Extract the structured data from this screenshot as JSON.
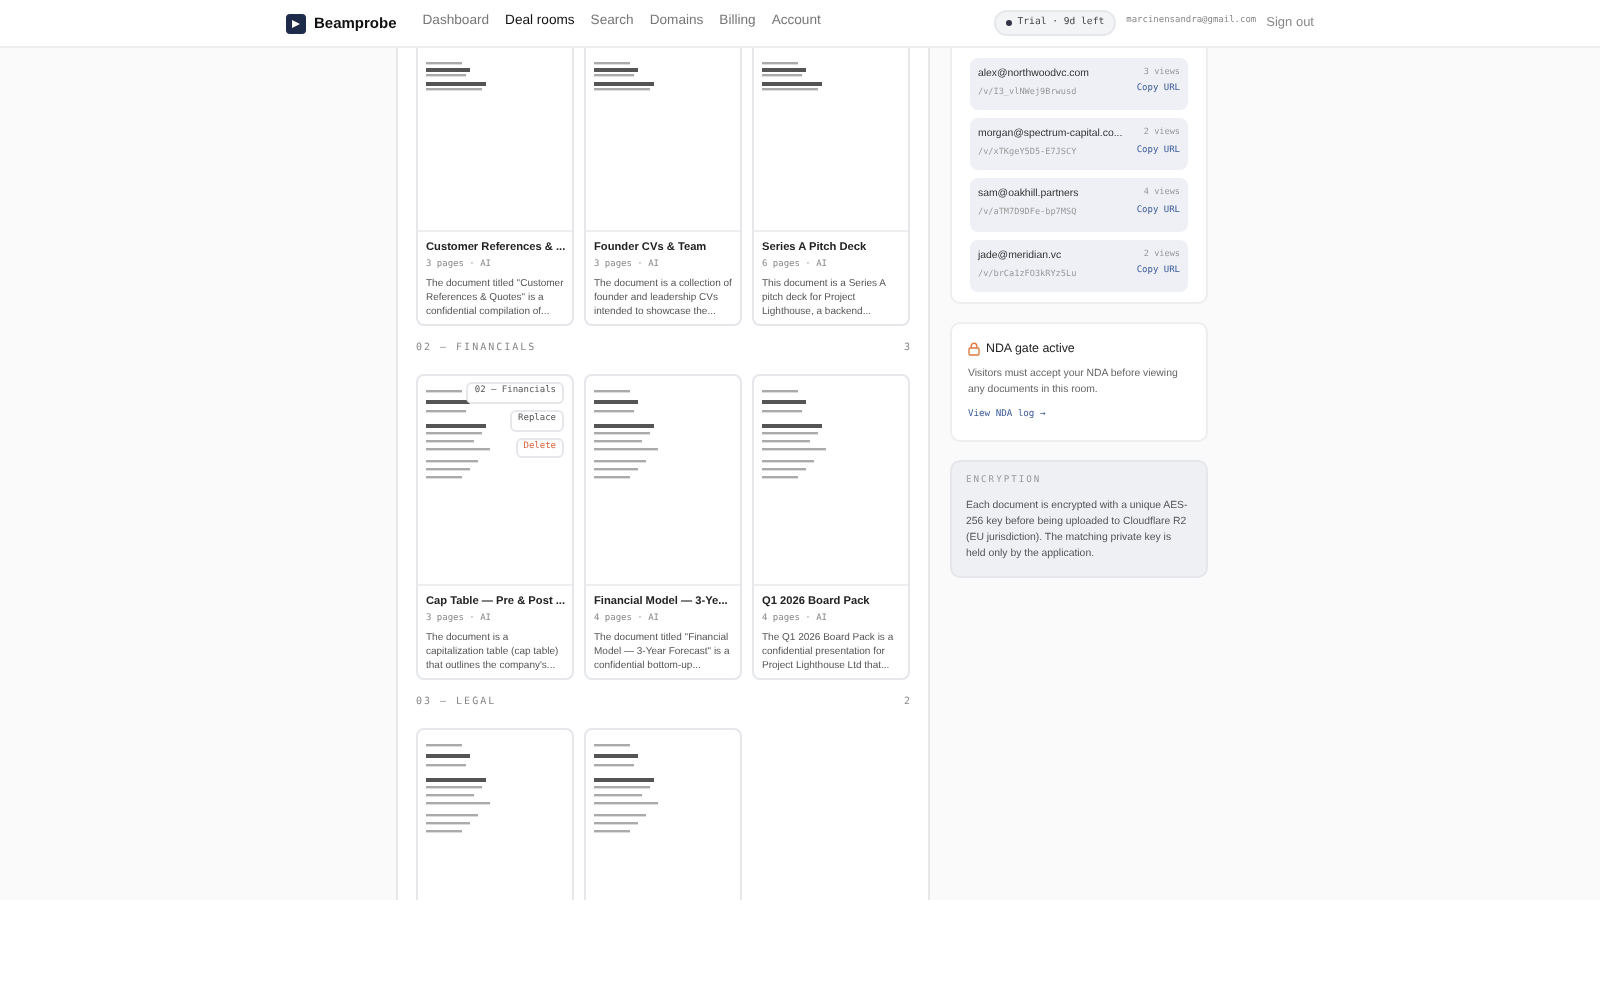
{
  "header": {
    "brand": "Beamprobe",
    "nav": [
      {
        "label": "Dashboard",
        "selected": false
      },
      {
        "label": "Deal rooms",
        "selected": true
      },
      {
        "label": "Search",
        "selected": false
      },
      {
        "label": "Domains",
        "selected": false
      },
      {
        "label": "Billing",
        "selected": false
      },
      {
        "label": "Account",
        "selected": false
      }
    ],
    "trial": "Trial · 9d left",
    "email": "marcinensandra@gmail.com",
    "sign_out": "Sign out"
  },
  "sections": [
    {
      "documents": [
        {
          "kind": "titled",
          "title": "Customer References & ...",
          "meta": "3 pages · AI",
          "description": "The document titled \"Customer References & Quotes\" is a confidential compilation of..."
        },
        {
          "kind": "titled",
          "title": "Founder CVs & Team",
          "meta": "3 pages · AI",
          "description": "The document is a collection of founder and leadership CVs intended to showcase the..."
        },
        {
          "kind": "titled",
          "title": "Series A Pitch Deck",
          "meta": "6 pages · AI",
          "description": "This document is a Series A pitch deck for Project Lighthouse, a backend..."
        }
      ]
    },
    {
      "label": "02 — FINANCIALS",
      "count": "3",
      "documents": [
        {
          "kind": "titled",
          "title": "Cap Table — Pre & Post ...",
          "meta": "3 pages · AI",
          "description": "The document is a capitalization table (cap table) that outlines the company's...",
          "actions": {
            "category": "02 — Financials",
            "buttons": [
              {
                "label": "Replace",
                "kind": "default"
              },
              {
                "label": "Delete",
                "kind": "danger"
              }
            ]
          }
        },
        {
          "kind": "titled",
          "title": "Financial Model — 3-Ye...",
          "meta": "4 pages · AI",
          "description": "The document titled \"Financial Model — 3-Year Forecast\" is a confidential bottom-up..."
        },
        {
          "kind": "titled",
          "title": "Q1 2026 Board Pack",
          "meta": "4 pages · AI",
          "description": "The Q1 2026 Board Pack is a confidential presentation for Project Lighthouse Ltd that..."
        }
      ]
    },
    {
      "label": "03 — LEGAL",
      "count": "2",
      "documents": [
        {
          "kind": "preview-only"
        },
        {
          "kind": "preview-only"
        }
      ]
    }
  ],
  "share_links": [
    {
      "email": "alex@northwoodvc.com",
      "path": "/v/I3_vlNWej9Brwusd",
      "views": "3 views",
      "copy": "Copy URL"
    },
    {
      "email": "morgan@spectrum-capital.co...",
      "path": "/v/xTKgeY5D5-E7JSCY",
      "views": "2 views",
      "copy": "Copy URL"
    },
    {
      "email": "sam@oakhill.partners",
      "path": "/v/aTM7D9DFe-bp7MSQ",
      "views": "4 views",
      "copy": "Copy URL"
    },
    {
      "email": "jade@meridian.vc",
      "path": "/v/brCa1zFO3kRYz5Lu",
      "views": "2 views",
      "copy": "Copy URL"
    }
  ],
  "nda": {
    "title": "NDA gate active",
    "text": "Visitors must accept your NDA before viewing any documents in this room.",
    "link": "View NDA log →"
  },
  "encryption": {
    "heading": "ENCRYPTION",
    "text": "Each document is encrypted with a unique AES-256 key before being uploaded to Cloudflare R2 (EU jurisdiction). The matching private key is held only by the application."
  }
}
